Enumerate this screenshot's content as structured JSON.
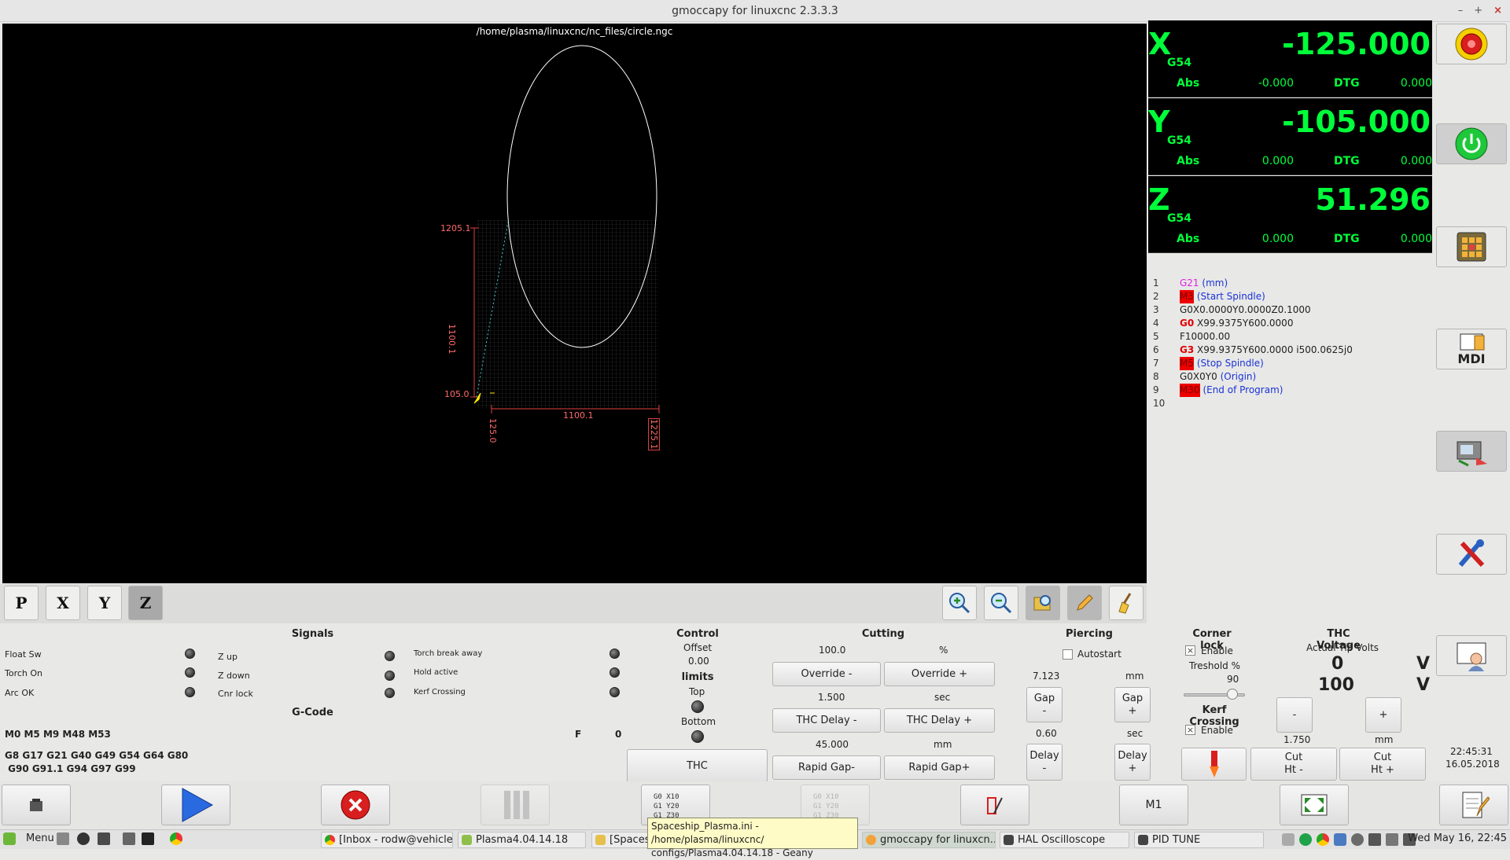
{
  "window": {
    "title": "gmoccapy for linuxcnc  2.3.3.3",
    "min": "–",
    "max": "+",
    "close": "×"
  },
  "preview": {
    "file_path": "/home/plasma/linuxcnc/nc_files/circle.ngc",
    "dim_y_top": "1205.1",
    "dim_y_span": "1100.1",
    "dim_y_bottom": "105.0",
    "dim_x_left": "125.0",
    "dim_x_span": "1100.1",
    "dim_x_right": "1225.1"
  },
  "view_buttons": [
    "P",
    "X",
    "Y",
    "Z"
  ],
  "dro": [
    {
      "axis": "X",
      "cs": "G54",
      "value": "-125.000",
      "abs_label": "Abs",
      "abs": "-0.000",
      "dtg_label": "DTG",
      "dtg": "0.000"
    },
    {
      "axis": "Y",
      "cs": "G54",
      "value": "-105.000",
      "abs_label": "Abs",
      "abs": "0.000",
      "dtg_label": "DTG",
      "dtg": "0.000"
    },
    {
      "axis": "Z",
      "cs": "G54",
      "value": "51.296",
      "abs_label": "Abs",
      "abs": "0.000",
      "dtg_label": "DTG",
      "dtg": "0.000"
    }
  ],
  "gcode_lines": [
    {
      "n": "1",
      "pre": "",
      "kw": "G21",
      "rest": "",
      "comment": " (mm)"
    },
    {
      "n": "2",
      "pre": "",
      "kw": "M3",
      "rest": "",
      "comment": " (Start Spindle)"
    },
    {
      "n": "3",
      "pre": "",
      "kw": "",
      "rest": "G0X0.0000Y0.0000Z0.1000",
      "comment": ""
    },
    {
      "n": "4",
      "pre": "",
      "kw": "G0",
      "rest": " X99.9375Y600.0000",
      "comment": ""
    },
    {
      "n": "5",
      "pre": "",
      "kw": "",
      "rest": "F10000.00",
      "comment": ""
    },
    {
      "n": "6",
      "pre": "",
      "kw": "G3",
      "rest": " X99.9375Y600.0000  i500.0625j0",
      "comment": ""
    },
    {
      "n": "7",
      "pre": "",
      "kw": "M5",
      "rest": "",
      "comment": " (Stop Spindle)"
    },
    {
      "n": "8",
      "pre": "",
      "kw": "",
      "rest": "G0X0Y0",
      "comment": " (Origin)"
    },
    {
      "n": "9",
      "pre": "",
      "kw": "M30",
      "rest": "",
      "comment": " (End of Program)"
    },
    {
      "n": "10",
      "pre": "",
      "kw": "",
      "rest": "",
      "comment": ""
    }
  ],
  "side_buttons": {
    "mdi_label": "MDI"
  },
  "signals": {
    "title": "Signals",
    "col1": [
      "Float Sw",
      "Torch On",
      "Arc OK"
    ],
    "col2": [
      "Z up",
      "Z down",
      "Cnr lock"
    ],
    "col3": [
      "Torch break away",
      "Hold active",
      "Kerf Crossing"
    ]
  },
  "gcode_status": {
    "title": "G-Code",
    "mcodes": "M0 M5 M9 M48 M53",
    "f_label": "F",
    "f_value": "0",
    "gcodes1": "G8 G17 G21 G40 G49 G54 G64 G80",
    "gcodes2": " G90 G91.1 G94 G97 G99"
  },
  "control": {
    "title": "Control",
    "offset_label": "Offset",
    "offset_value": "0.00",
    "limits": "limits",
    "top": "Top",
    "bottom": "Bottom",
    "thc": "THC"
  },
  "cutting": {
    "title": "Cutting",
    "override_value": "100.0",
    "override_unit": "%",
    "override_minus": "Override -",
    "override_plus": "Override +",
    "thc_delay_value": "1.500",
    "thc_delay_unit": "sec",
    "thc_delay_minus": "THC Delay -",
    "thc_delay_plus": "THC Delay +",
    "rapid_value": "45.000",
    "rapid_unit": "mm",
    "rapid_minus": "Rapid Gap-",
    "rapid_plus": "Rapid Gap+"
  },
  "piercing": {
    "title": "Piercing",
    "autostart": "Autostart",
    "gap_value": "7.123",
    "gap_unit": "mm",
    "gap_minus": "Gap\n-",
    "gap_plus": "Gap\n+",
    "delay_value": "0.60",
    "delay_unit": "sec",
    "delay_minus": "Delay\n-",
    "delay_plus": "Delay\n+"
  },
  "corner": {
    "title": "Corner lock",
    "enable": "Enable",
    "treshold": "Treshold %",
    "treshold_value": "90",
    "kerf_title": "Kerf Crossing",
    "kerf_enable": "Enable",
    "check": "×"
  },
  "thc_voltage": {
    "title": "THC Voltage",
    "sub": "Actual Tip Volts",
    "actual": "0",
    "set": "100",
    "unit": "V",
    "minus": "-",
    "plus": "+",
    "cut_ht_value": "1.750",
    "cut_ht_unit": "mm",
    "cut_ht_minus": "Cut\nHt -",
    "cut_ht_plus": "Cut\nHt +"
  },
  "datetime": {
    "time": "22:45:31",
    "date": "16.05.2018"
  },
  "bottom_buttons": {
    "m1": "M1"
  },
  "taskbar": {
    "menu": "Menu",
    "tasks": [
      "[Inbox - rodw@vehicle...",
      "Plasma4.04.14.18",
      "[Spaces",
      "gmoccapy for linuxcn...",
      "HAL Oscilloscope",
      "PID TUNE"
    ],
    "clock": "Wed May 16, 22:45"
  },
  "tooltip": {
    "line1": "Spaceship_Plasma.ini - /home/plasma/linuxcnc/",
    "line2": "configs/Plasma4.04.14.18 - Geany"
  },
  "colors": {
    "dro_green": "#00ff3a",
    "gcode_kw": "#e00000",
    "gcode_comment": "#1a33d6",
    "gcode_g21": "#e020e0"
  }
}
